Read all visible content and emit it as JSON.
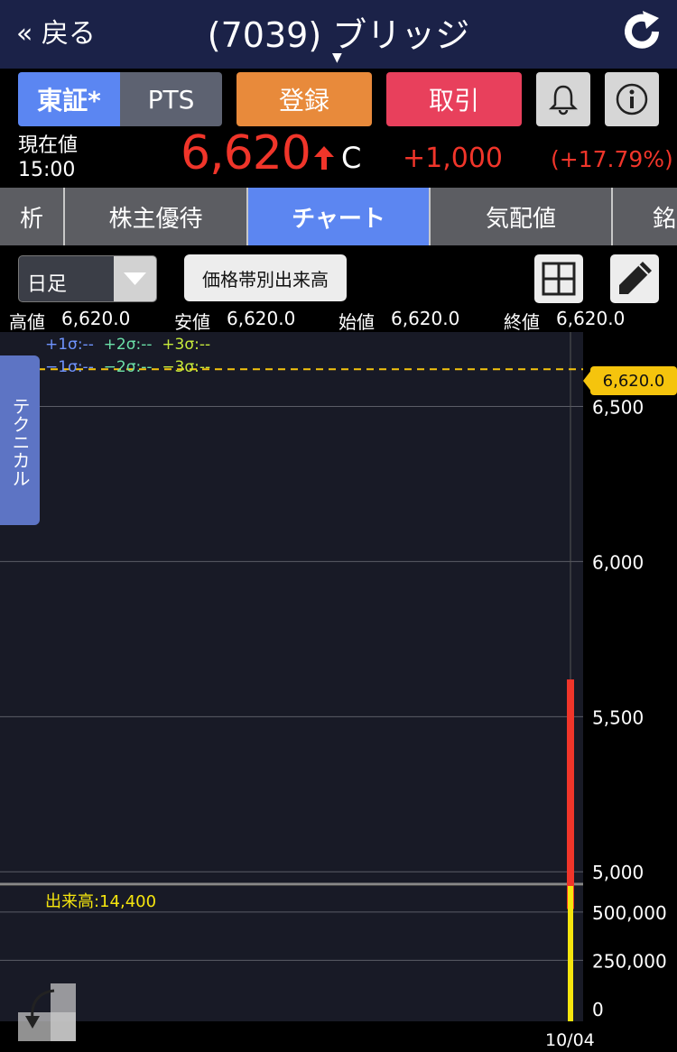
{
  "header": {
    "back_label": "« 戻る",
    "title": "(7039) ブリッジ",
    "title_caret": "▼"
  },
  "toolbar": {
    "market_tosho": "東証*",
    "market_pts": "PTS",
    "register_label": "登録",
    "trade_label": "取引"
  },
  "price": {
    "label": "現在値",
    "time": "15:00",
    "value": "6,620",
    "flag": "C",
    "change": "+1,000",
    "change_pct": "(+17.79%)"
  },
  "tabs": [
    "析",
    "株主優待",
    "チャート",
    "気配値",
    "銘"
  ],
  "chart_controls": {
    "period": "日足",
    "volume_profile_label": "価格帯別出来高"
  },
  "ohlc": {
    "high_label": "高値",
    "high": "6,620.0",
    "low_label": "安値",
    "low": "6,620.0",
    "open_label": "始値",
    "open": "6,620.0",
    "close_label": "終値",
    "close": "6,620.0"
  },
  "sigma": {
    "p1": "+1σ:--",
    "p2": "+2σ:--",
    "p3": "+3σ:--",
    "m1": "−1σ:--",
    "m2": "−2σ:--",
    "m3": "−3σ:--"
  },
  "technical_label": "テクニカル",
  "price_tag": "6,620.0",
  "volume_label": "出来高:14,400",
  "chart_data": {
    "type": "bar",
    "price_axis": {
      "ticks": [
        6500,
        6000,
        5500,
        5000
      ],
      "tick_labels": [
        "6,500",
        "6,000",
        "5,500",
        "5,000"
      ],
      "range": [
        4960,
        6740
      ]
    },
    "volume_axis": {
      "ticks": [
        500000,
        250000,
        0
      ],
      "tick_labels": [
        "500,000",
        "250,000",
        "0"
      ],
      "range": [
        0,
        700000
      ]
    },
    "candles": [
      {
        "date": "10/04",
        "open": 5620,
        "high": 6620,
        "low": 4880,
        "close": 4880
      }
    ],
    "current_price": 6620,
    "volume": [
      {
        "date": "10/04",
        "value": 700000
      }
    ],
    "x_label": "10/04"
  },
  "colors": {
    "accent": "#5b86f2",
    "up": "#f0352a",
    "price_line": "#f5c40d",
    "volume": "#f5e50e"
  }
}
